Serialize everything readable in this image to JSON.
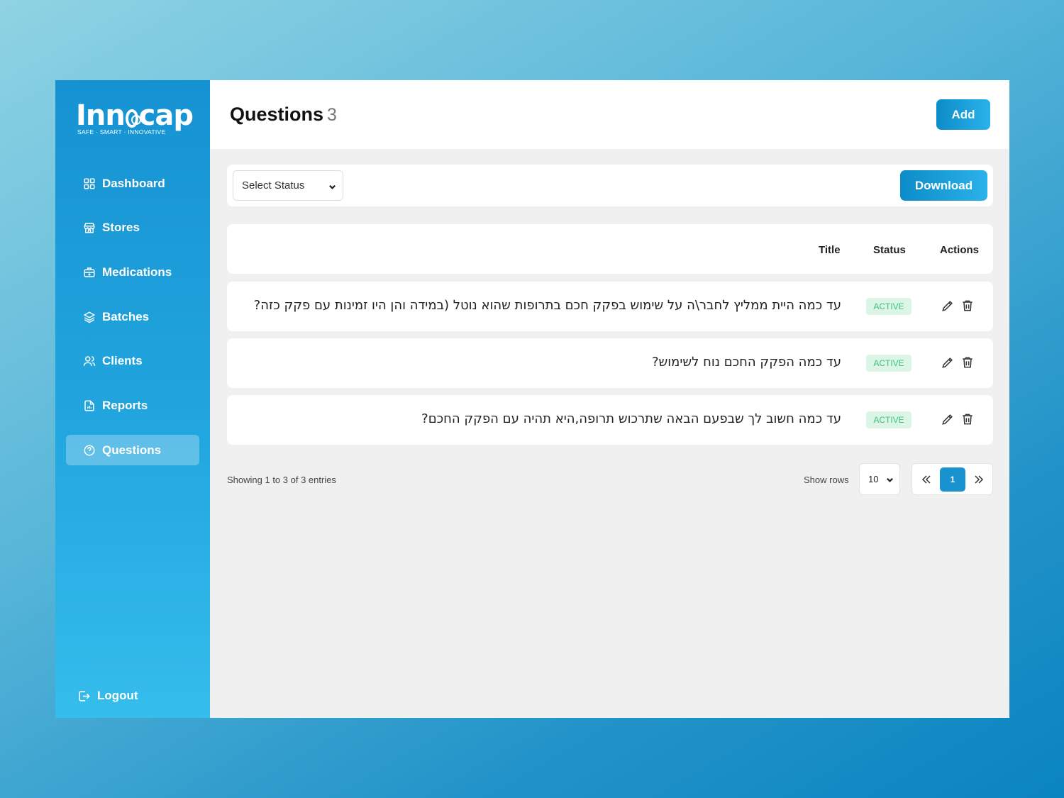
{
  "brand": {
    "name_part1": "Inn",
    "name_part2": "cap",
    "tagline": "SAFE · SMART · INNOVATIVE"
  },
  "sidebar": {
    "items": [
      {
        "label": "Dashboard",
        "icon": "grid-icon"
      },
      {
        "label": "Stores",
        "icon": "store-icon"
      },
      {
        "label": "Medications",
        "icon": "medkit-icon"
      },
      {
        "label": "Batches",
        "icon": "layers-icon"
      },
      {
        "label": "Clients",
        "icon": "users-icon"
      },
      {
        "label": "Reports",
        "icon": "report-icon"
      },
      {
        "label": "Questions",
        "icon": "question-circle-icon",
        "active": true
      }
    ],
    "logout_label": "Logout"
  },
  "header": {
    "title": "Questions",
    "count": "3",
    "add_label": "Add"
  },
  "filters": {
    "status_placeholder": "Select Status",
    "download_label": "Download"
  },
  "table": {
    "columns": [
      "Title",
      "Status",
      "Actions"
    ],
    "rows": [
      {
        "title": "עד כמה היית ממליץ לחבר\\ה על שימוש בפקק חכם בתרופות שהוא נוטל (במידה והן היו זמינות עם פקק כזה?",
        "status": "ACTIVE"
      },
      {
        "title": "עד כמה הפקק החכם נוח לשימוש?",
        "status": "ACTIVE"
      },
      {
        "title": "עד כמה חשוב לך שבפעם הבאה שתרכוש תרופה,היא תהיה עם הפקק החכם?",
        "status": "ACTIVE"
      }
    ]
  },
  "footer": {
    "showing": "Showing 1 to 3 of 3 entries",
    "rows_label": "Show rows",
    "rows_value": "10",
    "current_page": "1"
  },
  "colors": {
    "accent": "#1893cf",
    "sidebar_top": "#1692d2",
    "sidebar_bottom": "#35bdec",
    "active_badge_bg": "#dcf5e7",
    "active_badge_text": "#3fbf7f"
  }
}
